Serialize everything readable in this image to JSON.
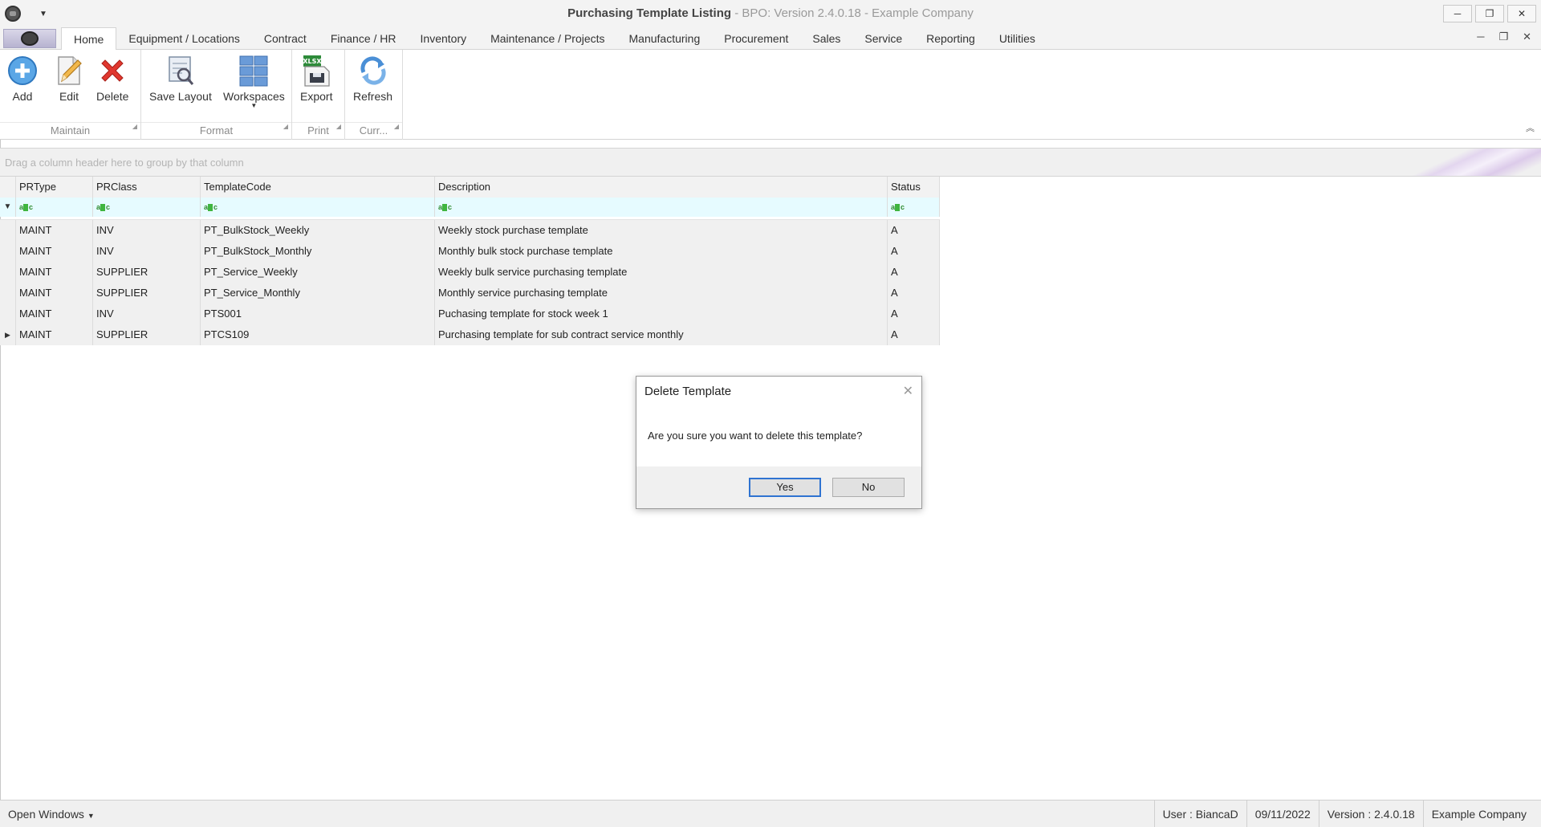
{
  "window": {
    "title_main": "Purchasing Template Listing",
    "title_sub": "BPO: Version 2.4.0.18 - Example Company"
  },
  "tabs": [
    {
      "label": "Home",
      "active": true
    },
    {
      "label": "Equipment / Locations"
    },
    {
      "label": "Contract"
    },
    {
      "label": "Finance / HR"
    },
    {
      "label": "Inventory"
    },
    {
      "label": "Maintenance / Projects"
    },
    {
      "label": "Manufacturing"
    },
    {
      "label": "Procurement"
    },
    {
      "label": "Sales"
    },
    {
      "label": "Service"
    },
    {
      "label": "Reporting"
    },
    {
      "label": "Utilities"
    }
  ],
  "ribbon": {
    "groups": {
      "maintain": "Maintain",
      "format": "Format",
      "print": "Print",
      "curr": "Curr..."
    },
    "buttons": {
      "add": "Add",
      "edit": "Edit",
      "delete": "Delete",
      "save_layout": "Save Layout",
      "workspaces": "Workspaces",
      "export": "Export",
      "refresh": "Refresh"
    }
  },
  "grid": {
    "group_hint": "Drag a column header here to group by that column",
    "columns": [
      "PRType",
      "PRClass",
      "TemplateCode",
      "Description",
      "Status"
    ],
    "rows": [
      [
        "MAINT",
        "INV",
        "PT_BulkStock_Weekly",
        "Weekly stock purchase template",
        "A"
      ],
      [
        "MAINT",
        "INV",
        "PT_BulkStock_Monthly",
        "Monthly bulk stock purchase template",
        "A"
      ],
      [
        "MAINT",
        "SUPPLIER",
        "PT_Service_Weekly",
        "Weekly bulk service purchasing template",
        "A"
      ],
      [
        "MAINT",
        "SUPPLIER",
        "PT_Service_Monthly",
        "Monthly service purchasing template",
        "A"
      ],
      [
        "MAINT",
        "INV",
        "PTS001",
        "Puchasing template for stock week 1",
        "A"
      ],
      [
        "MAINT",
        "SUPPLIER",
        "PTCS109",
        "Purchasing template for sub contract service monthly",
        "A"
      ]
    ],
    "current_row": 5
  },
  "dialog": {
    "title": "Delete Template",
    "message": "Are you sure you want to delete this template?",
    "yes": "Yes",
    "no": "No"
  },
  "statusbar": {
    "open_windows": "Open Windows",
    "user": "User : BiancaD",
    "date": "09/11/2022",
    "version": "Version : 2.4.0.18",
    "company": "Example Company"
  },
  "icons": {
    "add": "plus-circle-icon",
    "edit": "pencil-page-icon",
    "delete": "red-x-icon",
    "save_layout": "save-layout-icon",
    "workspaces": "grid-tiles-icon",
    "export": "xlsx-export-icon",
    "refresh": "refresh-icon"
  }
}
